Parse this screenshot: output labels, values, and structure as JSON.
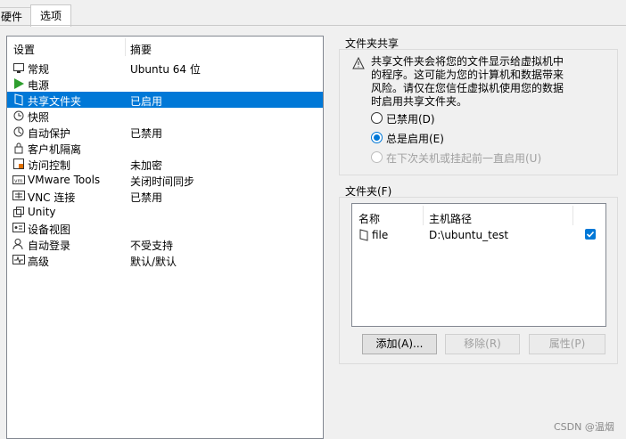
{
  "tabs": {
    "hardware": "硬件",
    "options": "选项"
  },
  "list": {
    "headers": {
      "setting": "设置",
      "summary": "摘要"
    },
    "items": [
      {
        "name": "常规",
        "summary": "Ubuntu 64 位",
        "icon": "general-icon"
      },
      {
        "name": "电源",
        "summary": "",
        "icon": "power-play-icon"
      },
      {
        "name": "共享文件夹",
        "summary": "已启用",
        "icon": "shared-folder-icon",
        "selected": true
      },
      {
        "name": "快照",
        "summary": "",
        "icon": "snapshot-icon"
      },
      {
        "name": "自动保护",
        "summary": "已禁用",
        "icon": "autoprotect-icon"
      },
      {
        "name": "客户机隔离",
        "summary": "",
        "icon": "isolation-lock-icon"
      },
      {
        "name": "访问控制",
        "summary": "未加密",
        "icon": "access-control-icon"
      },
      {
        "name": "VMware Tools",
        "summary": "关闭时间同步",
        "icon": "vmware-tools-icon"
      },
      {
        "name": "VNC 连接",
        "summary": "已禁用",
        "icon": "vnc-icon"
      },
      {
        "name": "Unity",
        "summary": "",
        "icon": "unity-icon"
      },
      {
        "name": "设备视图",
        "summary": "",
        "icon": "device-view-icon"
      },
      {
        "name": "自动登录",
        "summary": "不受支持",
        "icon": "autologin-icon"
      },
      {
        "name": "高级",
        "summary": "默认/默认",
        "icon": "advanced-icon"
      }
    ]
  },
  "sharing": {
    "title": "文件夹共享",
    "description_lines": [
      "共享文件夹会将您的文件显示给虚拟机中",
      "的程序。这可能为您的计算机和数据带来",
      "风险。请仅在您信任虚拟机使用您的数据",
      "时启用共享文件夹。"
    ],
    "options": [
      {
        "label": "已禁用(D)",
        "checked": false,
        "disabled": false
      },
      {
        "label": "总是启用(E)",
        "checked": true,
        "disabled": false
      },
      {
        "label": "在下次关机或挂起前一直启用(U)",
        "checked": false,
        "disabled": true
      }
    ]
  },
  "folders": {
    "title": "文件夹(F)",
    "headers": {
      "name": "名称",
      "path": "主机路径"
    },
    "rows": [
      {
        "name": "file",
        "path": "D:\\ubuntu_test",
        "enabled": true
      }
    ],
    "buttons": {
      "add": "添加(A)...",
      "remove": "移除(R)",
      "properties": "属性(P)"
    }
  },
  "watermark": "CSDN @温烟",
  "colors": {
    "selection": "#0078d7",
    "accent": "#0078d7"
  }
}
